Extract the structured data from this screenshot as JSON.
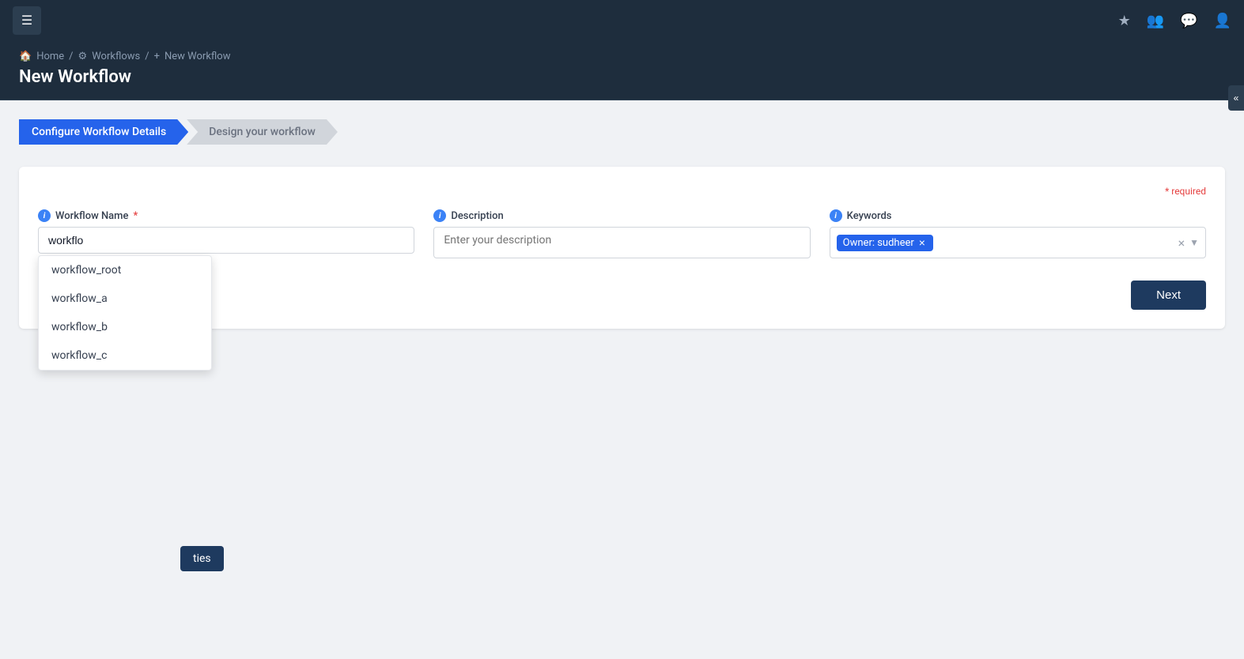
{
  "navbar": {
    "hamburger_label": "☰",
    "icons": [
      "★",
      "👥",
      "💬",
      "👤"
    ]
  },
  "breadcrumb": {
    "home": "Home",
    "workflows": "Workflows",
    "current": "New Workflow",
    "sep": "/"
  },
  "page_header": {
    "title": "New Workflow",
    "collapse_icon": "«"
  },
  "steps": [
    {
      "label": "Configure Workflow Details",
      "active": true
    },
    {
      "label": "Design your workflow",
      "active": false
    }
  ],
  "form": {
    "required_note": "* required",
    "workflow_name": {
      "label": "Workflow Name",
      "required": true,
      "value": "workflo",
      "info": "i"
    },
    "description": {
      "label": "Description",
      "placeholder": "Enter your description",
      "info": "i"
    },
    "keywords": {
      "label": "Keywords",
      "info": "i",
      "tags": [
        {
          "text": "Owner: sudheer"
        }
      ]
    }
  },
  "autocomplete": {
    "items": [
      "workflow_root",
      "workflow_a",
      "workflow_b",
      "workflow_c"
    ]
  },
  "partial_button": {
    "label": "ties"
  },
  "next_button": {
    "label": "Next"
  }
}
